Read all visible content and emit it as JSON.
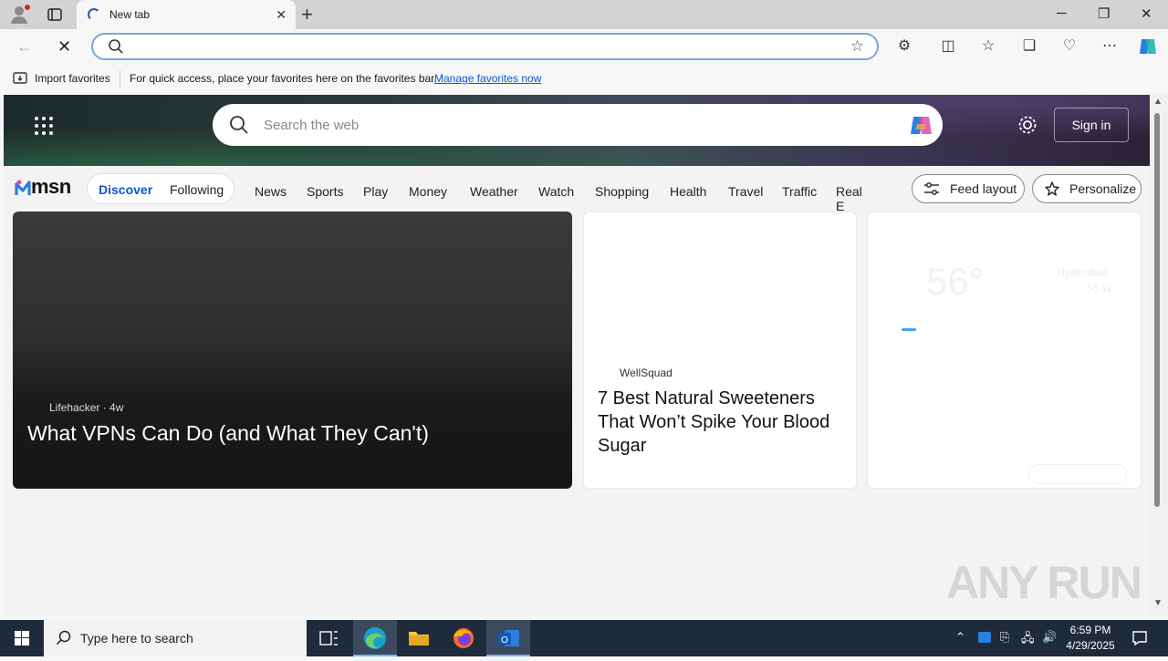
{
  "browser": {
    "tab_title": "New tab",
    "address_value": "",
    "favorites_bar": {
      "import_label": "Import favorites",
      "message": "For quick access, place your favorites here on the favorites bar.",
      "link": "Manage favorites now"
    }
  },
  "msn": {
    "search_placeholder": "Search the web",
    "sign_in": "Sign in",
    "logo_text": "msn",
    "feed_tabs": [
      "Discover",
      "Following"
    ],
    "nav_links": [
      "News",
      "Sports",
      "Play",
      "Money",
      "Weather",
      "Watch",
      "Shopping",
      "Health",
      "Travel",
      "Traffic",
      "Real E"
    ],
    "feed_layout": "Feed layout",
    "personalize": "Personalize",
    "cards": [
      {
        "source": "Lifehacker",
        "age": "4w",
        "title": "What VPNs Can Do (and What They Can't)"
      },
      {
        "source": "WellSquad",
        "title": "7 Best Natural Sweeteners That Won’t Spike Your Blood Sugar"
      }
    ],
    "weather": {
      "temp": "56",
      "unit": "°",
      "location": "Hyderabad",
      "hi": "56",
      "lo": "42"
    }
  },
  "watermark": "ANY RUN",
  "taskbar": {
    "search_placeholder": "Type here to search",
    "time": "6:59 PM",
    "date": "4/29/2025"
  },
  "colors": {
    "accent": "#0b57d0",
    "taskbar": "#1f2b3a"
  }
}
